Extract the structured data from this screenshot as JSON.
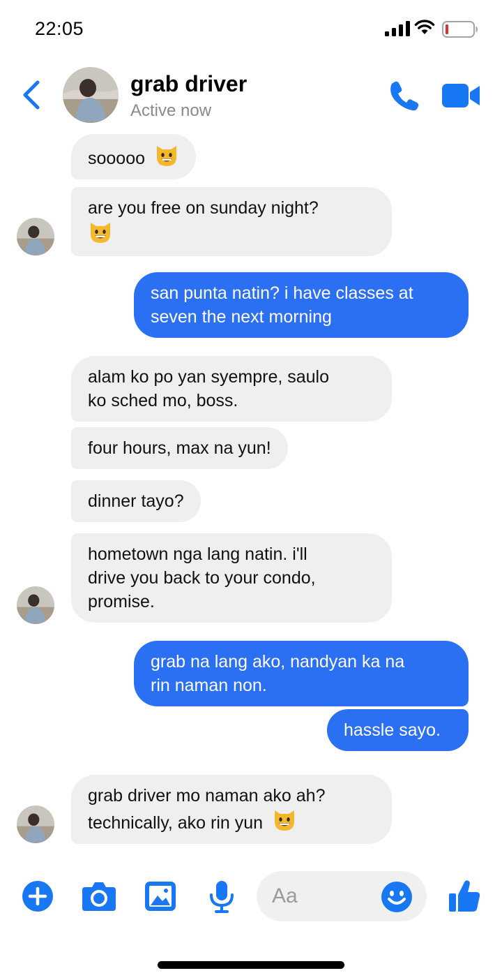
{
  "status_bar": {
    "time": "22:05"
  },
  "header": {
    "contact_name": "grab driver",
    "contact_status": "Active now"
  },
  "colors": {
    "accent": "#1877f2",
    "outgoing_bubble": "#2b6ff3",
    "incoming_bubble": "#efefef"
  },
  "messages": [
    {
      "from": "them",
      "lines": [
        "sooooo"
      ],
      "emoji": "grinning-cat-emoji"
    },
    {
      "from": "them",
      "lines": [
        "are you free on sunday night?"
      ],
      "emoji": "grinning-cat-emoji"
    },
    {
      "from": "me",
      "lines": [
        "san punta natin? i have classes at",
        "seven the next morning"
      ]
    },
    {
      "from": "them",
      "lines": [
        "alam ko po yan syempre, saulo",
        "ko sched mo, boss."
      ]
    },
    {
      "from": "them",
      "lines": [
        "four hours, max na yun!"
      ]
    },
    {
      "from": "them",
      "lines": [
        "dinner tayo?"
      ]
    },
    {
      "from": "them",
      "lines": [
        "hometown nga lang natin. i'll",
        "drive you back to your condo,",
        "promise."
      ]
    },
    {
      "from": "me",
      "lines": [
        "grab na lang ako, nandyan ka na",
        "rin naman non."
      ]
    },
    {
      "from": "me",
      "lines": [
        "hassle sayo."
      ]
    },
    {
      "from": "them",
      "lines": [
        "grab driver mo naman ako ah?",
        "technically, ako rin yun"
      ],
      "emoji": "grinning-cat-emoji"
    }
  ],
  "composer": {
    "placeholder": "Aa",
    "icons": [
      "plus-icon",
      "camera-icon",
      "gallery-icon",
      "microphone-icon",
      "emoji-icon",
      "thumbs-up-icon"
    ]
  }
}
